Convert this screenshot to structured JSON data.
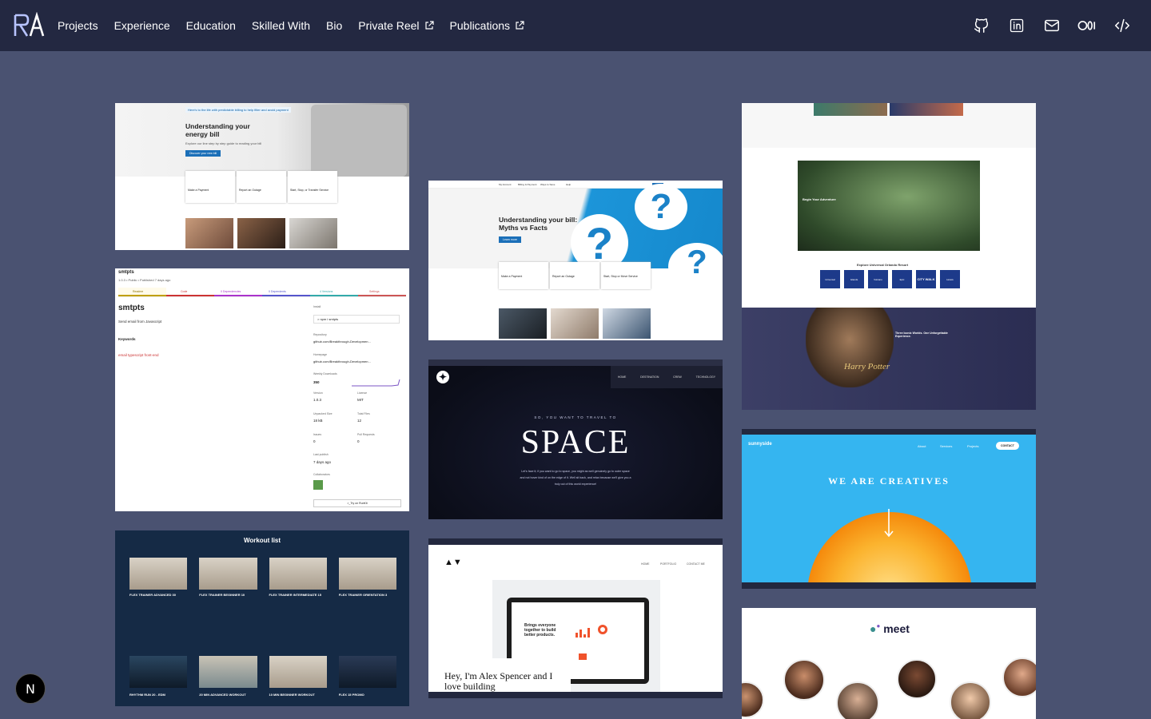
{
  "nav": {
    "items": [
      {
        "label": "Projects"
      },
      {
        "label": "Experience"
      },
      {
        "label": "Education"
      },
      {
        "label": "Skilled With"
      },
      {
        "label": "Bio"
      },
      {
        "label": "Private Reel",
        "external": true
      },
      {
        "label": "Publications",
        "external": true
      }
    ],
    "icons": [
      "github-icon",
      "linkedin-icon",
      "mail-icon",
      "medium-icon",
      "code-icon"
    ]
  },
  "cards": {
    "energy": {
      "banner": "Here's to the life with predictable billing to help filter and avoid payment",
      "title": "Understanding your energy bill",
      "sub": "Explore our line step by step guide to reading your bill",
      "btn": "Discover your new bill",
      "tiles": [
        "Make a Payment",
        "Report an Outage",
        "Start, Stop, or Transfer Service"
      ]
    },
    "myths": {
      "title": "Understanding your bill: Myths vs Facts",
      "btn": "Learn more",
      "tiles": [
        "Make a Payment",
        "Report an Outage",
        "Start, Stop or Move Service"
      ],
      "menu": [
        "My Account",
        "Billing & Payment",
        "Ways to Save",
        "Help"
      ]
    },
    "orlando": {
      "heading": "Explore Universal Orlando Resort",
      "adventure": "Begin Your Adventure",
      "hp_title": "Three Iconic Worlds. One Unforgettable Experience.",
      "hp_logo": "Harry Potter",
      "badges": [
        "Universal",
        "Islands",
        "Volcano",
        "Epic",
        "CITY WALK",
        "Hotels"
      ]
    },
    "smtpts": {
      "crumb": "smtpts",
      "meta": "1.0.3 • Public • Published 7 days ago",
      "tabs": [
        "Readme",
        "Code",
        "0 Dependencies",
        "0 Dependents",
        "4 Versions",
        "Settings"
      ],
      "name": "smtpts",
      "desc": "Send email from Javascript",
      "keywords_label": "Keywords",
      "keywords": "email  typescript  front-end",
      "install_label": "Install",
      "install_cmd": "> npm i smtpts",
      "repo_label": "Repository",
      "repo": "github.com/Breakthrough-Developmen...",
      "home_label": "Homepage",
      "home": "github.com/Breakthrough-Developmen...",
      "downloads_label": "Weekly Downloads",
      "downloads": "350",
      "version_label": "Version",
      "version": "1.0.3",
      "license_label": "License",
      "license": "MIT",
      "unpacked_label": "Unpacked Size",
      "unpacked": "18 kB",
      "files_label": "Total Files",
      "files": "12",
      "issues_label": "Issues",
      "issues": "0",
      "prs_label": "Pull Requests",
      "prs": "0",
      "published_label": "Last publish",
      "published": "7 days ago",
      "collab_label": "Collaborators",
      "try": ">_Try on RunKit"
    },
    "space": {
      "menu": [
        "HOME",
        "DESTINATION",
        "CREW",
        "TECHNOLOGY"
      ],
      "kicker": "SO, YOU WANT TO TRAVEL TO",
      "title": "SPACE",
      "body": "Let's face it; if you want to go to space, you might as well genuinely go to outer space and not hover kind of on the edge of it. Well sit back, and relax because we'll give you a truly out of this world experience!"
    },
    "sunny": {
      "brand": "sunnyside",
      "menu": [
        "About",
        "Services",
        "Projects"
      ],
      "contact": "CONTACT",
      "hero": "WE ARE CREATIVES"
    },
    "workout": {
      "title": "Workout list",
      "row1": [
        "FLEX TRAINER ADVANCED 30",
        "FLEX TRAINER BEGINNER 10",
        "FLEX TRAINER INTERMEDIATE 15",
        "FLEX TRAINER ORIENTATION 3"
      ],
      "row2": [
        "RHYTHM RUN 20 - EDM",
        "20 MIN ADVANCED WORKOUT",
        "10 MIN BEGINNER WORKOUT",
        "FLEX 15 PROMO"
      ]
    },
    "alex": {
      "menu": [
        "HOME",
        "PORTFOLIO",
        "CONTACT ME"
      ],
      "tagline": "Brings everyone together to build better products.",
      "hero": "Hey, I'm Alex Spencer and I love building"
    },
    "meet": {
      "brand": "meet"
    }
  },
  "badge": {
    "letter": "N"
  }
}
